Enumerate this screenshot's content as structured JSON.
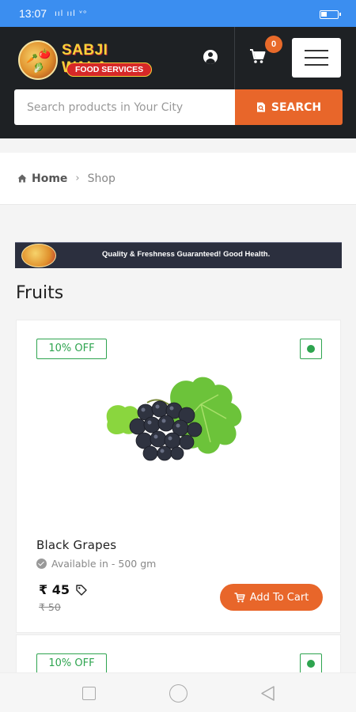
{
  "status_bar": {
    "time": "13:07",
    "signal_text": "ııl ııl ᵛᵒ",
    "battery_level": 0.35
  },
  "header": {
    "logo": {
      "title": "SABJI WALA",
      "subtitle": "FOOD SERVICES"
    },
    "icons": {
      "user": "user-circle-icon",
      "cart": "shopping-cart-icon",
      "menu": "hamburger-menu-icon"
    },
    "cart_count": "0",
    "search": {
      "placeholder": "Search products in Your City",
      "value": "",
      "button_label": "SEARCH"
    }
  },
  "breadcrumb": {
    "home_label": "Home",
    "separator": "›",
    "current_label": "Shop"
  },
  "banner": {
    "tagline": "Quality & Freshness Guaranteed! Good Health."
  },
  "section": {
    "title": "Fruits"
  },
  "products": [
    {
      "discount": "10% OFF",
      "name": "Black Grapes",
      "availability": "Available in - 500 gm",
      "price": "₹ 45",
      "old_price": "₹ 50",
      "button_label": "Add To Cart"
    },
    {
      "discount": "10% OFF"
    }
  ],
  "colors": {
    "status_bar": "#3b8ef0",
    "header_bg": "#1e2124",
    "accent_orange": "#e8662a",
    "veg_green": "#2ea44f"
  }
}
